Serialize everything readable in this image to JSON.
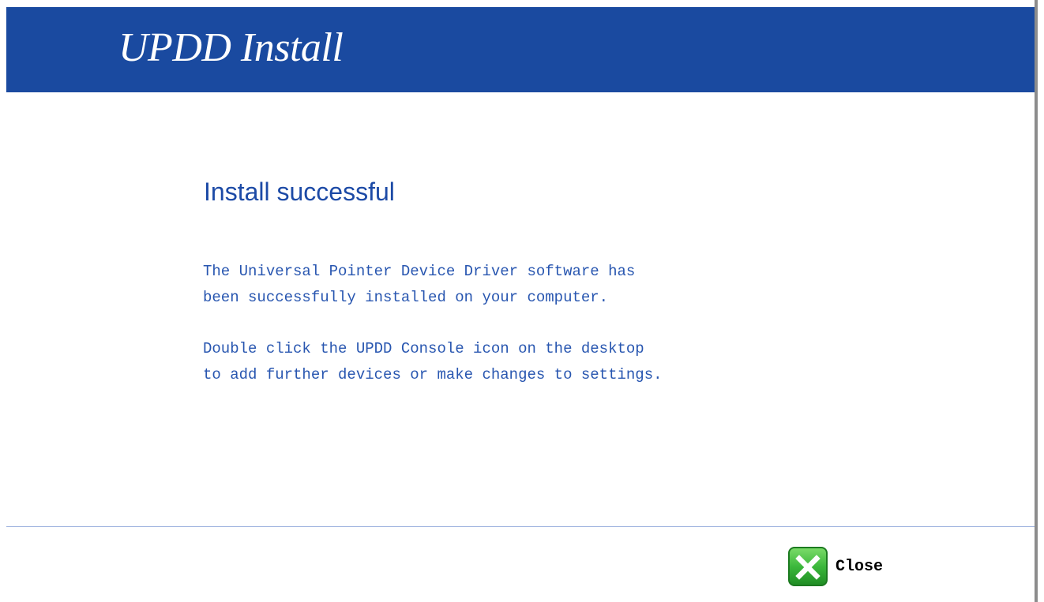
{
  "header": {
    "title": "UPDD Install"
  },
  "main": {
    "heading": "Install successful",
    "paragraph1": [
      "The Universal Pointer Device Driver software has",
      "been successfully installed on your computer."
    ],
    "paragraph2": [
      "Double click the UPDD Console icon on the desktop",
      "to add further devices or make changes to settings."
    ]
  },
  "footer": {
    "close_label": "Close",
    "close_icon": "close-x-icon"
  },
  "colors": {
    "header_bg": "#1a4aa0",
    "heading_text": "#1c4aa6",
    "body_text": "#2856b0",
    "close_icon_green": "#3cb83c",
    "divider": "#9db2de"
  }
}
